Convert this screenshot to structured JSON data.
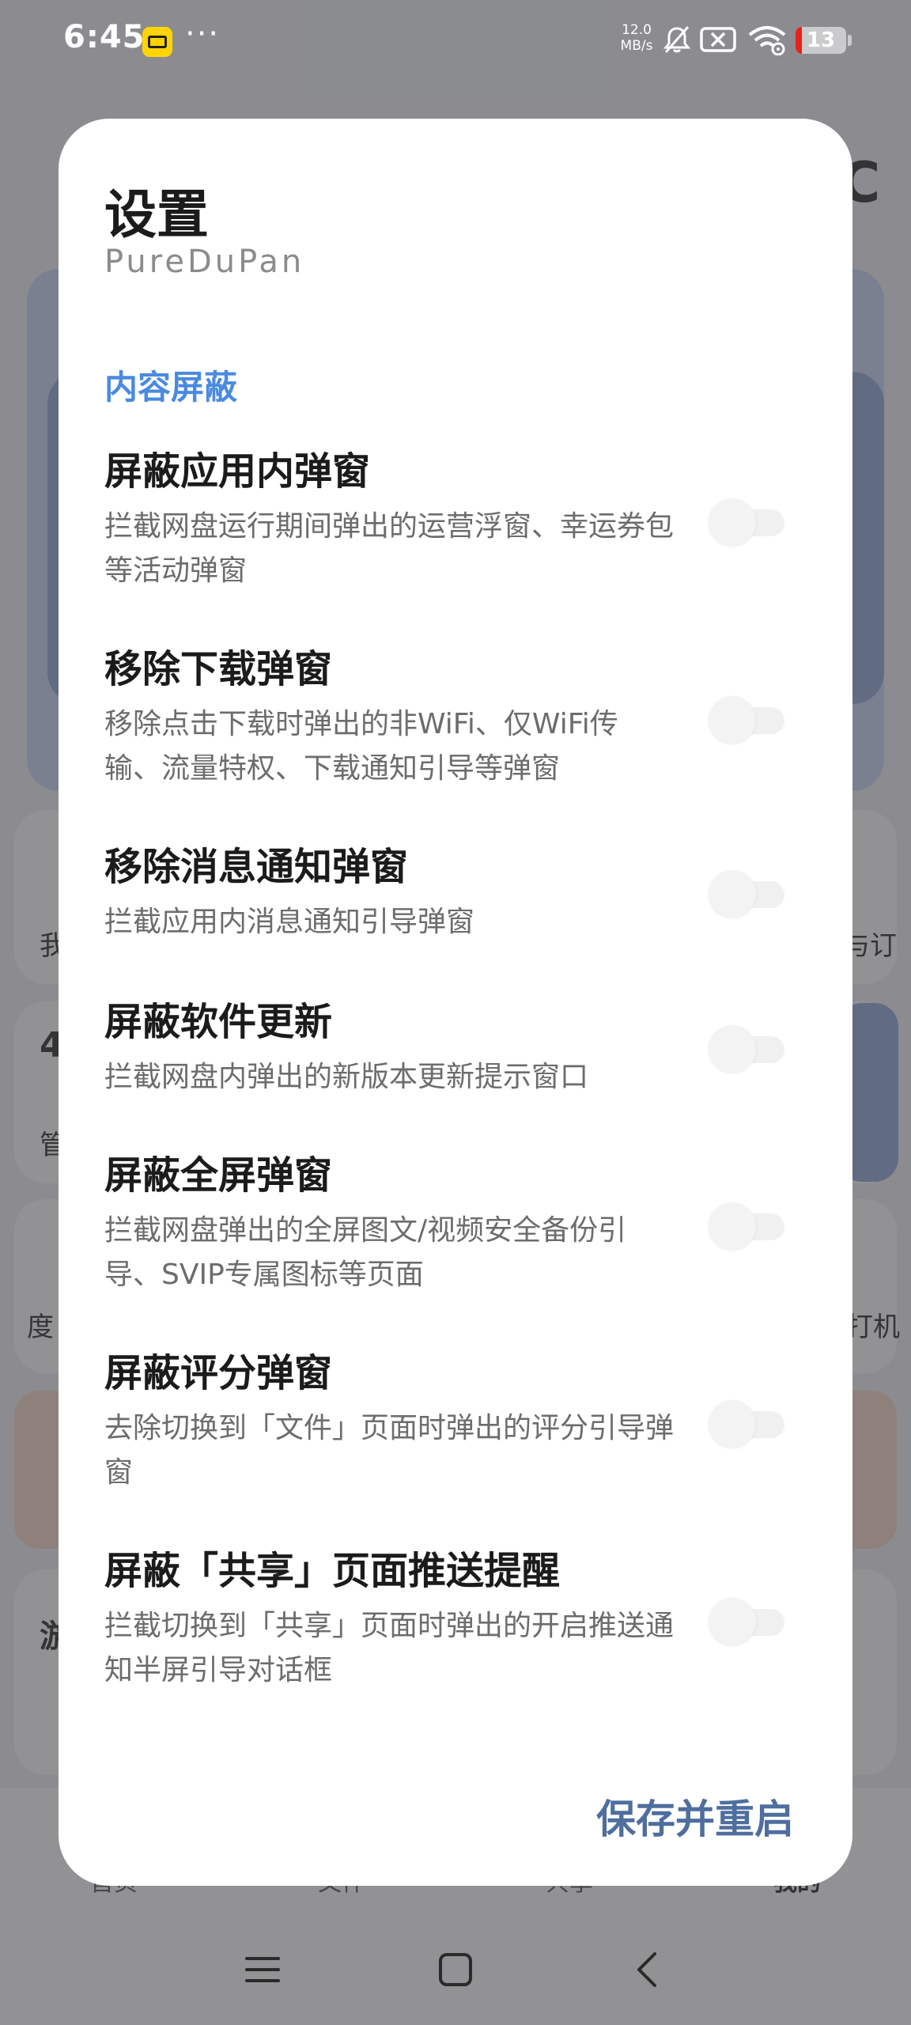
{
  "status_bar": {
    "time": "6:45",
    "more": "···",
    "net_speed_value": "12.0",
    "net_speed_unit": "MB/s",
    "battery_level": "13",
    "battery_color": "#e8201a",
    "icons": [
      "app-notification-icon",
      "bell-muted-icon",
      "sim-disabled-icon",
      "wifi-icon",
      "battery-icon"
    ]
  },
  "background_app": {
    "partial_texts": [
      "C",
      "我",
      "与订",
      "4",
      "管",
      "度",
      "打机",
      "游",
      "首页",
      "文件",
      "共享",
      "我的"
    ]
  },
  "dialog": {
    "title": "设置",
    "subtitle": "PureDuPan",
    "section": "内容屏蔽",
    "accent_color": "#4a8ae0",
    "items": [
      {
        "title": "屏蔽应用内弹窗",
        "description": "拦截网盘运行期间弹出的运营浮窗、幸运券包等活动弹窗",
        "enabled": false
      },
      {
        "title": "移除下载弹窗",
        "description": "移除点击下载时弹出的非WiFi、仅WiFi传输、流量特权、下载通知引导等弹窗",
        "enabled": false
      },
      {
        "title": "移除消息通知弹窗",
        "description": "拦截应用内消息通知引导弹窗",
        "enabled": false
      },
      {
        "title": "屏蔽软件更新",
        "description": "拦截网盘内弹出的新版本更新提示窗口",
        "enabled": false
      },
      {
        "title": "屏蔽全屏弹窗",
        "description": "拦截网盘弹出的全屏图文/视频安全备份引导、SVIP专属图标等页面",
        "enabled": false
      },
      {
        "title": "屏蔽评分弹窗",
        "description": "去除切换到「文件」页面时弹出的评分引导弹窗",
        "enabled": false
      },
      {
        "title": "屏蔽「共享」页面推送提醒",
        "description": "拦截切换到「共享」页面时弹出的开启推送通知半屏引导对话框",
        "enabled": false
      }
    ],
    "save_label": "保存并重启",
    "save_color": "#4f6e9e"
  },
  "nav_bar": {
    "icons": [
      "menu-icon",
      "home-square-icon",
      "back-chevron-icon"
    ]
  }
}
